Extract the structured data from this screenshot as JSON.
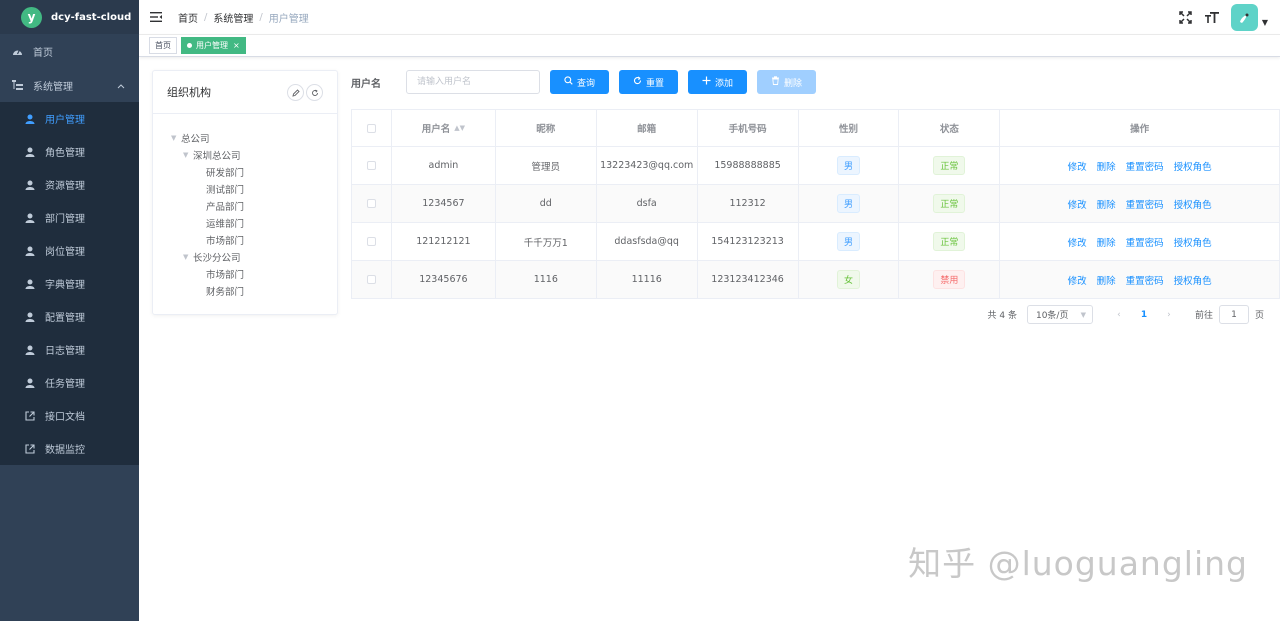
{
  "app": {
    "title": "dcy-fast-cloud",
    "logo_letter": "y",
    "accent": "#42b983",
    "sidebar_bg": "#304156",
    "primary": "#1890ff"
  },
  "sidebar": {
    "home": "首页",
    "system": "系统管理",
    "items": [
      {
        "label": "用户管理",
        "icon": "user-icon",
        "active": true
      },
      {
        "label": "角色管理",
        "icon": "user-icon"
      },
      {
        "label": "资源管理",
        "icon": "user-icon"
      },
      {
        "label": "部门管理",
        "icon": "user-icon"
      },
      {
        "label": "岗位管理",
        "icon": "user-icon"
      },
      {
        "label": "字典管理",
        "icon": "user-icon"
      },
      {
        "label": "配置管理",
        "icon": "user-icon"
      },
      {
        "label": "日志管理",
        "icon": "user-icon"
      },
      {
        "label": "任务管理",
        "icon": "user-icon"
      },
      {
        "label": "接口文档",
        "icon": "external-link-icon"
      },
      {
        "label": "数据监控",
        "icon": "external-link-icon"
      }
    ]
  },
  "breadcrumb": [
    "首页",
    "系统管理",
    "用户管理"
  ],
  "tags": {
    "home": "首页",
    "active": "用户管理",
    "close": "×"
  },
  "org": {
    "title": "组织机构",
    "tree": [
      {
        "label": "总公司",
        "level": 0,
        "expanded": true
      },
      {
        "label": "深圳总公司",
        "level": 1,
        "expanded": true
      },
      {
        "label": "研发部门",
        "level": 2
      },
      {
        "label": "测试部门",
        "level": 2
      },
      {
        "label": "产品部门",
        "level": 2
      },
      {
        "label": "运维部门",
        "level": 2
      },
      {
        "label": "市场部门",
        "level": 2
      },
      {
        "label": "长沙分公司",
        "level": 1,
        "expanded": true
      },
      {
        "label": "市场部门",
        "level": 2
      },
      {
        "label": "财务部门",
        "level": 2
      }
    ]
  },
  "search": {
    "label": "用户名",
    "placeholder": "请输入用户名"
  },
  "buttons": {
    "query": "查询",
    "reset": "重置",
    "add": "添加",
    "delete": "删除"
  },
  "table": {
    "headers": [
      "用户名",
      "昵称",
      "邮箱",
      "手机号码",
      "性别",
      "状态",
      "操作"
    ],
    "rows": [
      {
        "username": "admin",
        "nickname": "管理员",
        "email": "13223423@qq.com",
        "phone": "15988888885",
        "gender": "男",
        "status": "正常"
      },
      {
        "username": "1234567",
        "nickname": "dd",
        "email": "dsfa",
        "phone": "112312",
        "gender": "男",
        "status": "正常"
      },
      {
        "username": "121212121",
        "nickname": "千千万万1",
        "email": "ddasfsda@qq",
        "phone": "154123123213",
        "gender": "男",
        "status": "正常"
      },
      {
        "username": "12345676",
        "nickname": "1116",
        "email": "11116",
        "phone": "123123412346",
        "gender": "女",
        "status": "禁用"
      }
    ],
    "actions": [
      "修改",
      "删除",
      "重置密码",
      "授权角色"
    ]
  },
  "pagination": {
    "total": "共 4 条",
    "page_size": "10条/页",
    "current": "1",
    "goto_label": "前往",
    "goto_value": "1",
    "goto_suffix": "页"
  },
  "watermark": "知乎 @luoguangling"
}
